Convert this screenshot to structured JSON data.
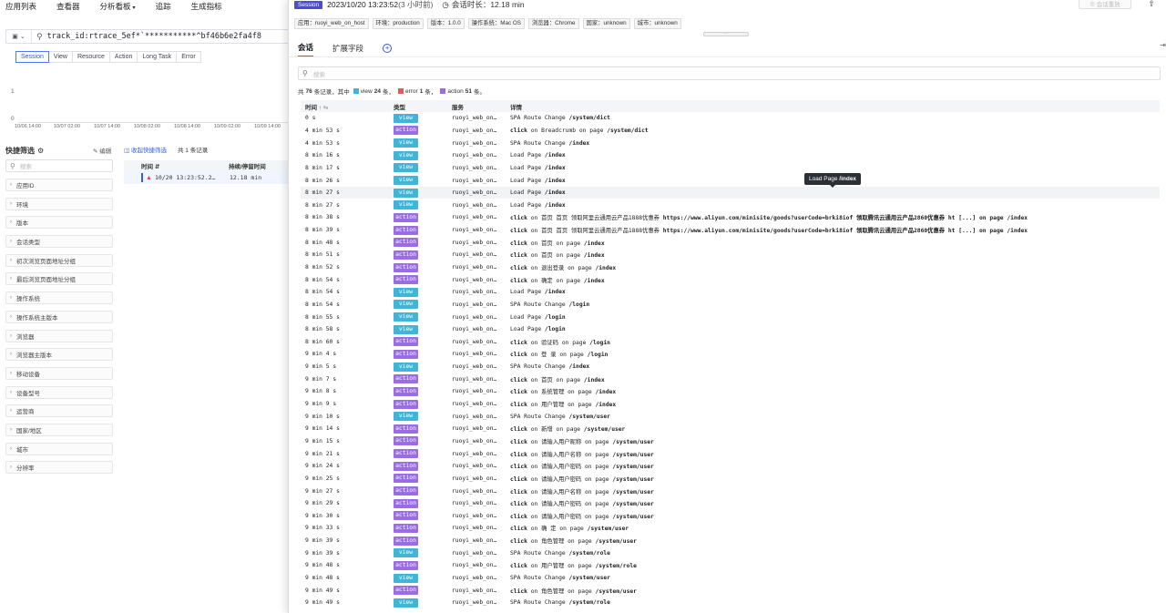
{
  "topnav": {
    "items": [
      "应用列表",
      "查看器",
      "分析看板",
      "追踪",
      "生成指标"
    ]
  },
  "search": {
    "query": "track_id:rtrace_5ef*`***********^bf46b6e2fa4f8"
  },
  "left_tabs": [
    "Session",
    "View",
    "Resource",
    "Action",
    "Long Task",
    "Error"
  ],
  "mini_chart": {
    "y_ticks": [
      "1",
      "0"
    ],
    "x_ticks": [
      "10/06 14:00",
      "10/07 02:00",
      "10/07 14:00",
      "10/08 02:00",
      "10/08 14:00",
      "10/09 02:00",
      "10/09 14:00"
    ]
  },
  "quick_filter": {
    "title": "快捷筛选",
    "edit_label": "编辑",
    "search_placeholder": "搜索",
    "items": [
      "应用ID",
      "环境",
      "版本",
      "会话类型",
      "初次浏览页面地址分组",
      "最后浏览页面地址分组",
      "操作系统",
      "操作系统主版本",
      "浏览器",
      "浏览器主版本",
      "移动设备",
      "设备型号",
      "运营商",
      "国家/地区",
      "城市",
      "分辨率"
    ]
  },
  "session_list": {
    "collapse_label": "收起快捷筛选",
    "count_label": "共 1 条记录",
    "col_time": "时间",
    "col_duration": "持续/停留时间",
    "row_time": "10/20 13:23:52.2…",
    "row_duration": "12.18 min"
  },
  "drawer": {
    "badge": "Session",
    "datetime": "2023/10/20 13:23:52",
    "ago": "(3 小时前)",
    "duration_label": "会话时长：12.18 min",
    "replay_label": "会话重放",
    "tags": [
      "应用：ruoyi_web_on_host",
      "环境：production",
      "版本：1.0.0",
      "操作系统：Mac OS",
      "浏览器：Chrome",
      "国家：unknown",
      "城市：unknown"
    ],
    "tabs": [
      "会话",
      "扩展字段"
    ],
    "search_placeholder": "搜索",
    "summary": {
      "prefix": "共",
      "total": "76",
      "mid": "条记录，其中",
      "view_label": "view",
      "view_count": "24",
      "error_label": "error",
      "error_count": "1",
      "action_label": "action",
      "action_count": "51",
      "unit": "条",
      "end": "条。"
    },
    "colors": {
      "view": "#40b5d7",
      "action": "#9a6ce6",
      "error": "#e05a5a"
    },
    "columns": {
      "time": "时间",
      "type": "类型",
      "service": "服务",
      "detail": "详情"
    },
    "tooltip": {
      "pre": "Load Page",
      "path": "/index"
    },
    "rows": [
      {
        "time": "0 s",
        "type": "view",
        "service": "ruoyi_web_on…",
        "pre": "SPA Route Change",
        "mid": "",
        "post": "",
        "path": "/system/dict"
      },
      {
        "time": "4 min 53 s",
        "type": "action",
        "service": "ruoyi_web_on…",
        "pre": "click",
        "mid": "on Breadcrumb on page",
        "post": "",
        "path": "/system/dict"
      },
      {
        "time": "4 min 53 s",
        "type": "view",
        "service": "ruoyi_web_on…",
        "pre": "SPA Route Change",
        "mid": "",
        "post": "",
        "path": "/index"
      },
      {
        "time": "8 min 16 s",
        "type": "view",
        "service": "ruoyi_web_on…",
        "pre": "Load Page",
        "mid": "",
        "post": "",
        "path": "/index"
      },
      {
        "time": "8 min 17 s",
        "type": "view",
        "service": "ruoyi_web_on…",
        "pre": "Load Page",
        "mid": "",
        "post": "",
        "path": "/index"
      },
      {
        "time": "8 min 26 s",
        "type": "view",
        "service": "ruoyi_web_on…",
        "pre": "Load Page",
        "mid": "",
        "post": "",
        "path": "/index"
      },
      {
        "time": "8 min 27 s",
        "type": "view",
        "service": "ruoyi_web_on…",
        "pre": "Load Page",
        "mid": "",
        "post": "",
        "path": "/index"
      },
      {
        "time": "8 min 27 s",
        "type": "view",
        "service": "ruoyi_web_on…",
        "pre": "Load Page",
        "mid": "",
        "post": "",
        "path": "/index"
      },
      {
        "time": "8 min 38 s",
        "type": "action",
        "service": "ruoyi_web_on…",
        "pre": "click",
        "mid": "on 首页 首页 领取阿里云通用云产品1888优惠券",
        "post": "https://www.aliyun.com/minisite/goods?userCode=brki8iof 领取腾讯云通用云产品2860优惠券 ht [...]",
        "path": "on page /index"
      },
      {
        "time": "8 min 39 s",
        "type": "action",
        "service": "ruoyi_web_on…",
        "pre": "click",
        "mid": "on 首页 首页 领取阿里云通用云产品1888优惠券",
        "post": "https://www.aliyun.com/minisite/goods?userCode=brki8iof 领取腾讯云通用云产品2860优惠券 ht [...]",
        "path": "on page /index"
      },
      {
        "time": "8 min 48 s",
        "type": "action",
        "service": "ruoyi_web_on…",
        "pre": "click",
        "mid": "on 首页 on page",
        "post": "",
        "path": "/index"
      },
      {
        "time": "8 min 51 s",
        "type": "action",
        "service": "ruoyi_web_on…",
        "pre": "click",
        "mid": "on 首页 on page",
        "post": "",
        "path": "/index"
      },
      {
        "time": "8 min 52 s",
        "type": "action",
        "service": "ruoyi_web_on…",
        "pre": "click",
        "mid": "on 退出登录 on page",
        "post": "",
        "path": "/index"
      },
      {
        "time": "8 min 54 s",
        "type": "action",
        "service": "ruoyi_web_on…",
        "pre": "click",
        "mid": "on 确定 on page",
        "post": "",
        "path": "/index"
      },
      {
        "time": "8 min 54 s",
        "type": "view",
        "service": "ruoyi_web_on…",
        "pre": "Load Page",
        "mid": "",
        "post": "",
        "path": "/index"
      },
      {
        "time": "8 min 54 s",
        "type": "view",
        "service": "ruoyi_web_on…",
        "pre": "SPA Route Change",
        "mid": "",
        "post": "",
        "path": "/login"
      },
      {
        "time": "8 min 55 s",
        "type": "view",
        "service": "ruoyi_web_on…",
        "pre": "Load Page",
        "mid": "",
        "post": "",
        "path": "/login"
      },
      {
        "time": "8 min 58 s",
        "type": "view",
        "service": "ruoyi_web_on…",
        "pre": "Load Page",
        "mid": "",
        "post": "",
        "path": "/login"
      },
      {
        "time": "8 min 60 s",
        "type": "action",
        "service": "ruoyi_web_on…",
        "pre": "click",
        "mid": "on 验证码 on page",
        "post": "",
        "path": "/login"
      },
      {
        "time": "9 min 4 s",
        "type": "action",
        "service": "ruoyi_web_on…",
        "pre": "click",
        "mid": "on 登 录 on page",
        "post": "",
        "path": "/login"
      },
      {
        "time": "9 min 5 s",
        "type": "view",
        "service": "ruoyi_web_on…",
        "pre": "SPA Route Change",
        "mid": "",
        "post": "",
        "path": "/index"
      },
      {
        "time": "9 min 7 s",
        "type": "action",
        "service": "ruoyi_web_on…",
        "pre": "click",
        "mid": "on 首页 on page",
        "post": "",
        "path": "/index"
      },
      {
        "time": "9 min 8 s",
        "type": "action",
        "service": "ruoyi_web_on…",
        "pre": "click",
        "mid": "on 系统管理 on page",
        "post": "",
        "path": "/index"
      },
      {
        "time": "9 min 9 s",
        "type": "action",
        "service": "ruoyi_web_on…",
        "pre": "click",
        "mid": "on 用户管理 on page",
        "post": "",
        "path": "/index"
      },
      {
        "time": "9 min 10 s",
        "type": "view",
        "service": "ruoyi_web_on…",
        "pre": "SPA Route Change",
        "mid": "",
        "post": "",
        "path": "/system/user"
      },
      {
        "time": "9 min 14 s",
        "type": "action",
        "service": "ruoyi_web_on…",
        "pre": "click",
        "mid": "on 新增 on page",
        "post": "",
        "path": "/system/user"
      },
      {
        "time": "9 min 15 s",
        "type": "action",
        "service": "ruoyi_web_on…",
        "pre": "click",
        "mid": "on 请输入用户昵称 on page",
        "post": "",
        "path": "/system/user"
      },
      {
        "time": "9 min 21 s",
        "type": "action",
        "service": "ruoyi_web_on…",
        "pre": "click",
        "mid": "on 请输入用户名称 on page",
        "post": "",
        "path": "/system/user"
      },
      {
        "time": "9 min 24 s",
        "type": "action",
        "service": "ruoyi_web_on…",
        "pre": "click",
        "mid": "on 请输入用户密码 on page",
        "post": "",
        "path": "/system/user"
      },
      {
        "time": "9 min 25 s",
        "type": "action",
        "service": "ruoyi_web_on…",
        "pre": "click",
        "mid": "on 请输入用户密码 on page",
        "post": "",
        "path": "/system/user"
      },
      {
        "time": "9 min 27 s",
        "type": "action",
        "service": "ruoyi_web_on…",
        "pre": "click",
        "mid": "on 请输入用户名称 on page",
        "post": "",
        "path": "/system/user"
      },
      {
        "time": "9 min 29 s",
        "type": "action",
        "service": "ruoyi_web_on…",
        "pre": "click",
        "mid": "on 请输入用户密码 on page",
        "post": "",
        "path": "/system/user"
      },
      {
        "time": "9 min 30 s",
        "type": "action",
        "service": "ruoyi_web_on…",
        "pre": "click",
        "mid": "on 请输入用户密码 on page",
        "post": "",
        "path": "/system/user"
      },
      {
        "time": "9 min 33 s",
        "type": "action",
        "service": "ruoyi_web_on…",
        "pre": "click",
        "mid": "on 确 定 on page",
        "post": "",
        "path": "/system/user"
      },
      {
        "time": "9 min 39 s",
        "type": "action",
        "service": "ruoyi_web_on…",
        "pre": "click",
        "mid": "on 角色管理 on page",
        "post": "",
        "path": "/system/user"
      },
      {
        "time": "9 min 39 s",
        "type": "view",
        "service": "ruoyi_web_on…",
        "pre": "SPA Route Change",
        "mid": "",
        "post": "",
        "path": "/system/role"
      },
      {
        "time": "9 min 48 s",
        "type": "action",
        "service": "ruoyi_web_on…",
        "pre": "click",
        "mid": "on 用户管理 on page",
        "post": "",
        "path": "/system/role"
      },
      {
        "time": "9 min 48 s",
        "type": "view",
        "service": "ruoyi_web_on…",
        "pre": "SPA Route Change",
        "mid": "",
        "post": "",
        "path": "/system/user"
      },
      {
        "time": "9 min 49 s",
        "type": "action",
        "service": "ruoyi_web_on…",
        "pre": "click",
        "mid": "on 角色管理 on page",
        "post": "",
        "path": "/system/user"
      },
      {
        "time": "9 min 49 s",
        "type": "view",
        "service": "ruoyi_web_on…",
        "pre": "SPA Route Change",
        "mid": "",
        "post": "",
        "path": "/system/role"
      }
    ]
  }
}
